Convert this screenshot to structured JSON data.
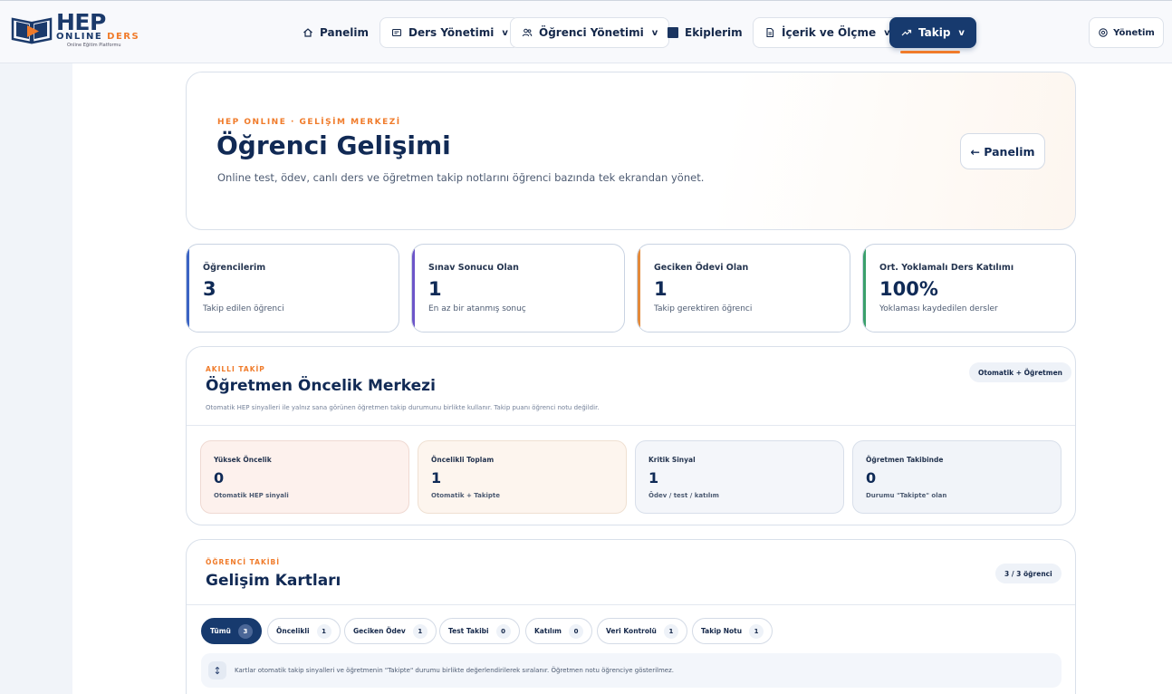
{
  "brand": {
    "name": "HEP",
    "sub_online": "ONLINE",
    "sub_ders": "DERS",
    "tagline": "Online Eğitim Platformu"
  },
  "nav": {
    "items": [
      {
        "label": "Panelim",
        "icon": "home-icon"
      },
      {
        "label": "Ders Yönetimi",
        "icon": "chalkboard-icon",
        "chevron": "v"
      },
      {
        "label": "Öğrenci Yönetimi",
        "icon": "users-icon",
        "chevron": "v"
      },
      {
        "label": "Ekiplerim",
        "icon": "square-icon"
      },
      {
        "label": "İçerik ve Ölçme",
        "icon": "document-icon",
        "chevron": "v"
      },
      {
        "label": "Takip",
        "icon": "trend-icon",
        "chevron": "v"
      }
    ],
    "admin_label": "Yönetim"
  },
  "hero": {
    "eyebrow": "HEP ONLINE · GELİŞİM MERKEZİ",
    "title": "Öğrenci Gelişimi",
    "description": "Online test, ödev, canlı ders ve öğretmen takip notlarını öğrenci bazında tek ekrandan yönet.",
    "back_label": "← Panelim"
  },
  "stats": [
    {
      "label": "Öğrencilerim",
      "value": "3",
      "sub": "Takip edilen öğrenci",
      "color": "#3a63c4"
    },
    {
      "label": "Sınav Sonucu Olan",
      "value": "1",
      "sub": "En az bir atanmış sonuç",
      "color": "#6c55c9"
    },
    {
      "label": "Geciken Ödevi Olan",
      "value": "1",
      "sub": "Takip gerektiren öğrenci",
      "color": "#e48a3a"
    },
    {
      "label": "Ort. Yoklamalı Ders Katılımı",
      "value": "100%",
      "sub": "Yoklaması kaydedilen dersler",
      "color": "#3aa06b"
    }
  ],
  "priority": {
    "eyebrow": "AKILLI TAKİP",
    "title": "Öğretmen Öncelik Merkezi",
    "note": "Otomatik HEP sinyalleri ile yalnız sana görünen öğretmen takip durumunu birlikte kullanır. Takip puanı öğrenci notu değildir.",
    "badge": "Otomatik + Öğretmen",
    "cards": [
      {
        "label": "Yüksek Öncelik",
        "value": "0",
        "sub": "Otomatik HEP sinyali",
        "bg": "#fdf1ed"
      },
      {
        "label": "Öncelikli Toplam",
        "value": "1",
        "sub": "Otomatik + Takipte",
        "bg": "#fdf5ee"
      },
      {
        "label": "Kritik Sinyal",
        "value": "1",
        "sub": "Ödev / test / katılım",
        "bg": "#f4f6fa"
      },
      {
        "label": "Öğretmen Takibinde",
        "value": "0",
        "sub": "Durumu \"Takipte\" olan",
        "bg": "#f1f4f9"
      }
    ]
  },
  "tracking": {
    "eyebrow": "ÖĞRENCİ TAKİBİ",
    "title": "Gelişim Kartları",
    "badge": "3 / 3 öğrenci",
    "filters": [
      {
        "label": "Tümü",
        "count": "3"
      },
      {
        "label": "Öncelikli",
        "count": "1"
      },
      {
        "label": "Geciken Ödev",
        "count": "1"
      },
      {
        "label": "Test Takibi",
        "count": "0"
      },
      {
        "label": "Katılım",
        "count": "0"
      },
      {
        "label": "Veri Kontrolü",
        "count": "1"
      },
      {
        "label": "Takip Notu",
        "count": "1"
      }
    ],
    "info_icon": "sort-icon",
    "info": "Kartlar otomatik takip sinyalleri ve öğretmenin \"Takipte\" durumu birlikte değerlendirilerek sıralanır. Öğretmen notu öğrenciye gösterilmez."
  }
}
